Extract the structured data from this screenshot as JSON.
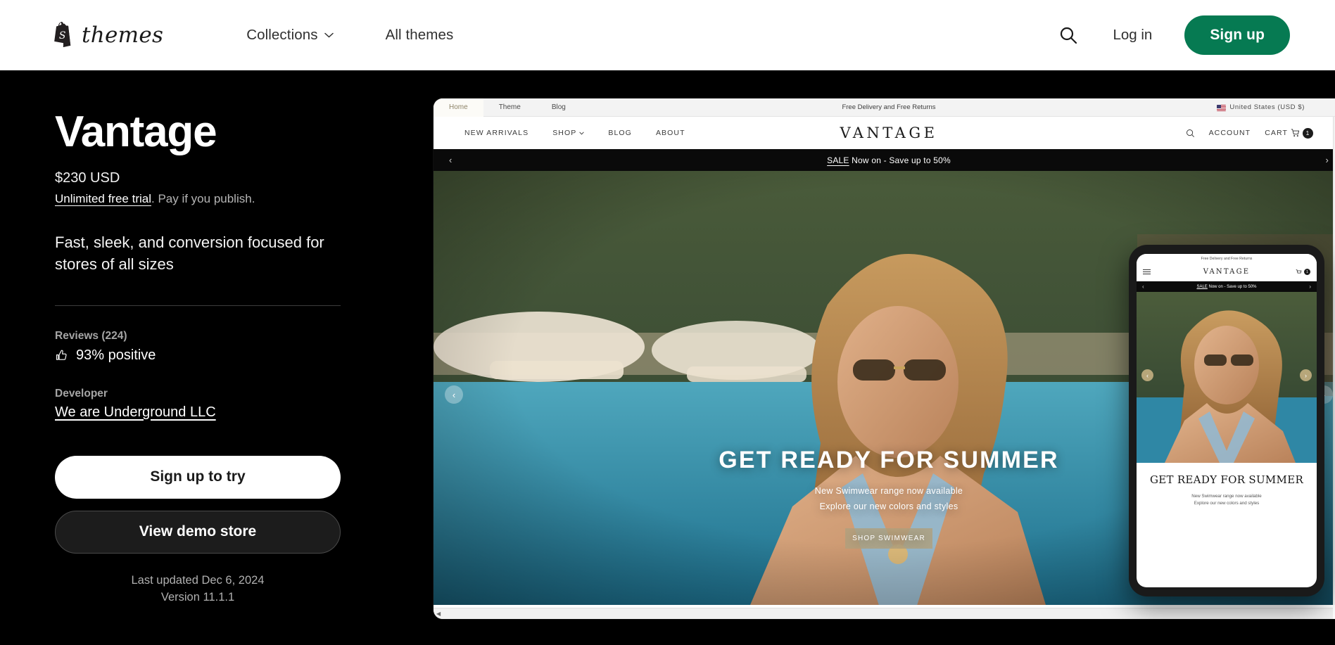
{
  "header": {
    "logo_word": "themes",
    "nav": [
      {
        "label": "Collections",
        "has_chevron": true
      },
      {
        "label": "All themes",
        "has_chevron": false
      }
    ],
    "search_icon": "search-icon",
    "login_label": "Log in",
    "signup_label": "Sign up",
    "accent_green": "#067a52"
  },
  "sidebar": {
    "title": "Vantage",
    "price": "$230 USD",
    "trial_link": "Unlimited free trial",
    "trial_rest": ". Pay if you publish.",
    "tagline": "Fast, sleek, and conversion focused for stores of all sizes",
    "reviews_label": "Reviews (224)",
    "reviews_value": "93% positive",
    "developer_label": "Developer",
    "developer_name": "We are Underground LLC",
    "primary_button": "Sign up to try",
    "secondary_button": "View demo store",
    "last_updated": "Last updated Dec 6, 2024",
    "version": "Version 11.1.1"
  },
  "preview": {
    "tabs": [
      {
        "label": "Home",
        "active": true
      },
      {
        "label": "Theme",
        "active": false
      },
      {
        "label": "Blog",
        "active": false
      }
    ],
    "announcement": "Free Delivery and Free Returns",
    "country": "United States (USD $)",
    "store_nav": [
      {
        "label": "NEW ARRIVALS",
        "has_chevron": false
      },
      {
        "label": "SHOP",
        "has_chevron": true
      },
      {
        "label": "BLOG",
        "has_chevron": false
      },
      {
        "label": "ABOUT",
        "has_chevron": false
      }
    ],
    "store_logo": "VANTAGE",
    "account_label": "ACCOUNT",
    "cart_label": "CART",
    "cart_count": "1",
    "sale_prefix": "SALE",
    "sale_text": " Now on - Save up to 50%",
    "hero_title": "GET READY FOR SUMMER",
    "hero_sub_line1": "New Swimwear range now available",
    "hero_sub_line2": "Explore our new colors and styles",
    "hero_button": "SHOP SWIMWEAR",
    "arrow_left": "‹",
    "arrow_right": "›"
  },
  "phone": {
    "announcement": "Free Delivery and Free Returns",
    "logo": "VANTAGE",
    "cart_count": "1",
    "sale_prefix": "SALE",
    "sale_text": " Now on - Save up to 50%",
    "hero_title": "GET READY FOR SUMMER",
    "hero_sub_line1": "New Swimwear range now available",
    "hero_sub_line2": "Explore our new colors and styles",
    "arrow_left": "‹",
    "arrow_right": "›"
  }
}
